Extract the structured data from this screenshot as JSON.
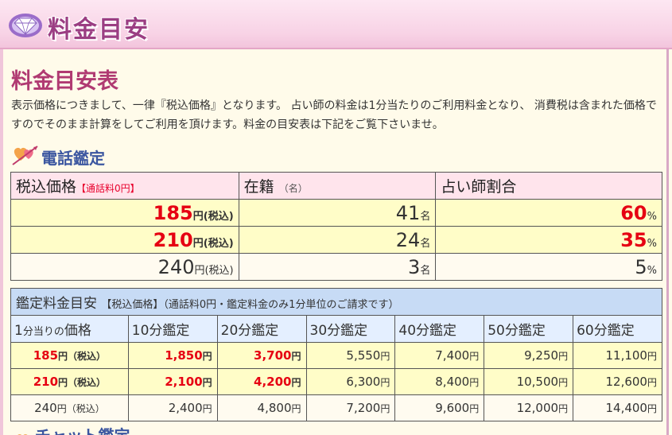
{
  "header": {
    "title": "料金目安",
    "icon": "gem-icon"
  },
  "page": {
    "title": "料金目安表",
    "intro": "表示価格につきまして、一律『税込価格』となります。 占い師の料金は1分当たりのご利用料金となり、 消費税は含まれた価格ですのでそのまま計算をしてご利用を頂けます。料金の目安表は下記をご覧下さいませ。"
  },
  "section": {
    "title": "電話鑑定",
    "icon": "heart-arrow-icon"
  },
  "price_table": {
    "headers": {
      "price": "税込価格",
      "price_note": "【通話料0円】",
      "count": "在籍",
      "count_note": "（名）",
      "ratio": "占い師割合"
    },
    "rows": [
      {
        "price": "185",
        "price_unit": "円(税込)",
        "count": "41",
        "count_unit": "名",
        "ratio": "60",
        "ratio_unit": "%"
      },
      {
        "price": "210",
        "price_unit": "円(税込)",
        "count": "24",
        "count_unit": "名",
        "ratio": "35",
        "ratio_unit": "%"
      },
      {
        "price": "240",
        "price_unit": "円(税込)",
        "count": "3",
        "count_unit": "名",
        "ratio": "5",
        "ratio_unit": "%"
      }
    ]
  },
  "fee_table": {
    "title": "鑑定料金目安",
    "note": "【税込価格】（通話料0円・鑑定料金のみ1分単位のご請求です）",
    "col_first": "1分当りの価格",
    "col_first_a": "1",
    "col_first_b": "分当りの",
    "col_first_c": "価格",
    "cols": [
      "10分鑑定",
      "20分鑑定",
      "30分鑑定",
      "40分鑑定",
      "50分鑑定",
      "60分鑑定"
    ],
    "yen": "円",
    "rows": [
      {
        "price": "185",
        "unit": "円（税込）",
        "values": [
          "1,850",
          "3,700",
          "5,550",
          "7,400",
          "9,250",
          "11,100"
        ]
      },
      {
        "price": "210",
        "unit": "円（税込）",
        "values": [
          "2,100",
          "4,200",
          "6,300",
          "8,400",
          "10,500",
          "12,600"
        ]
      },
      {
        "price": "240",
        "unit": "円（税込）",
        "values": [
          "2,400",
          "4,800",
          "7,200",
          "9,600",
          "12,000",
          "14,400"
        ]
      }
    ]
  },
  "next_section": {
    "title": "チャット鑑定"
  }
}
